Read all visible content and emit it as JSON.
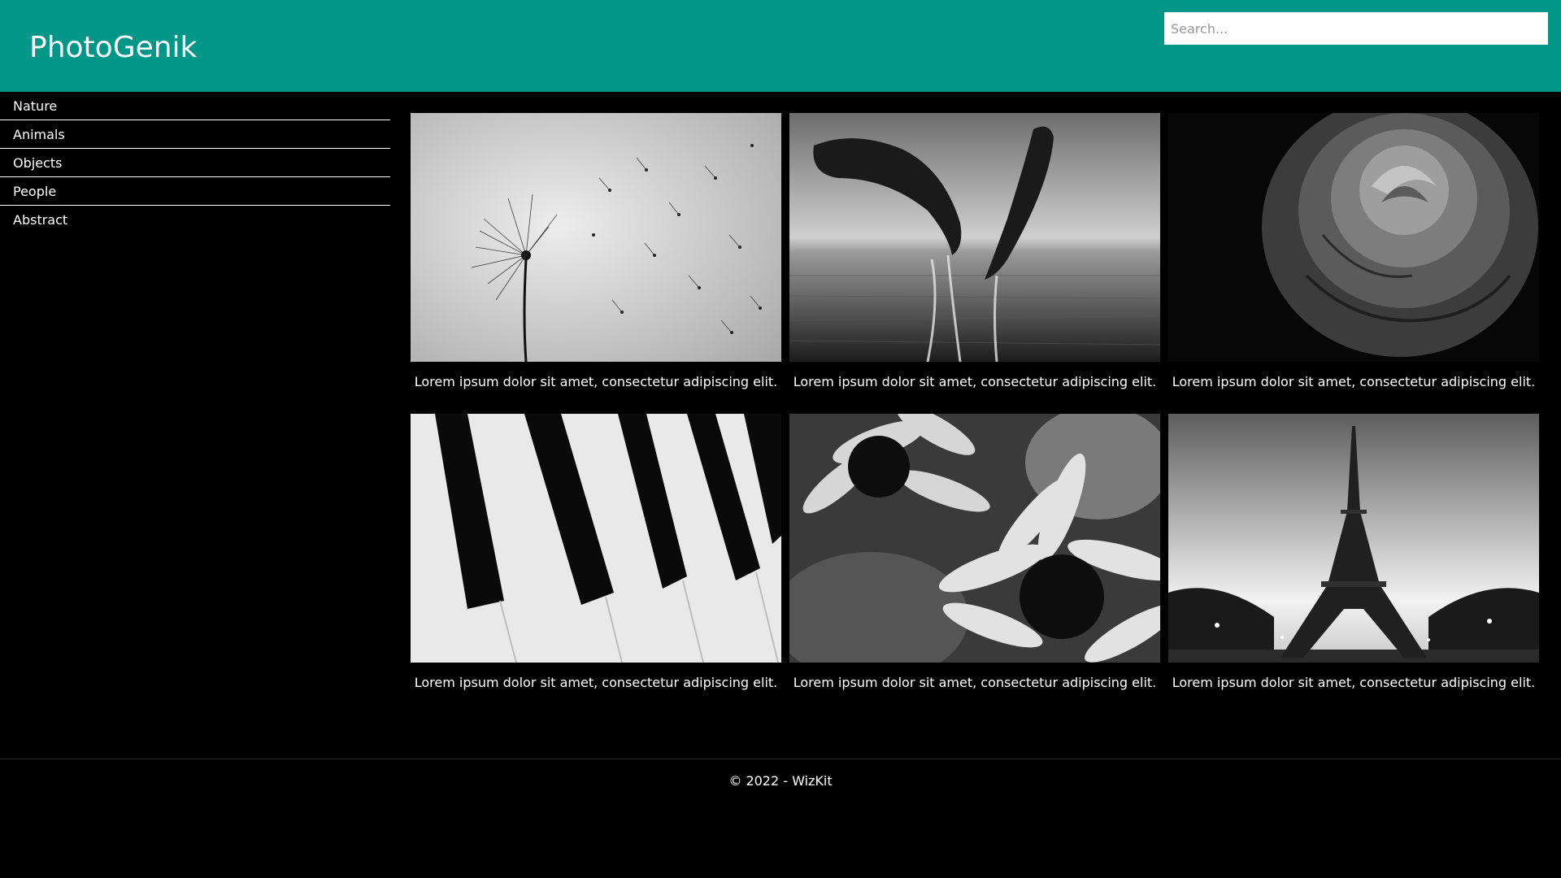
{
  "header": {
    "brand": "PhotoGenik",
    "search_placeholder": "Search...",
    "color": "#009688"
  },
  "sidebar": {
    "items": [
      {
        "label": "Nature"
      },
      {
        "label": "Animals"
      },
      {
        "label": "Objects"
      },
      {
        "label": "People"
      },
      {
        "label": "Abstract"
      }
    ]
  },
  "gallery": {
    "cards": [
      {
        "subject": "dandelion",
        "caption": "Lorem ipsum dolor sit amet, consectetur adipiscing elit."
      },
      {
        "subject": "dolphins",
        "caption": "Lorem ipsum dolor sit amet, consectetur adipiscing elit."
      },
      {
        "subject": "rose",
        "caption": "Lorem ipsum dolor sit amet, consectetur adipiscing elit."
      },
      {
        "subject": "piano-keys",
        "caption": "Lorem ipsum dolor sit amet, consectetur adipiscing elit."
      },
      {
        "subject": "daisies",
        "caption": "Lorem ipsum dolor sit amet, consectetur adipiscing elit."
      },
      {
        "subject": "eiffel-tower",
        "caption": "Lorem ipsum dolor sit amet, consectetur adipiscing elit."
      }
    ]
  },
  "footer": {
    "copyright": "© 2022 - WizKit"
  }
}
